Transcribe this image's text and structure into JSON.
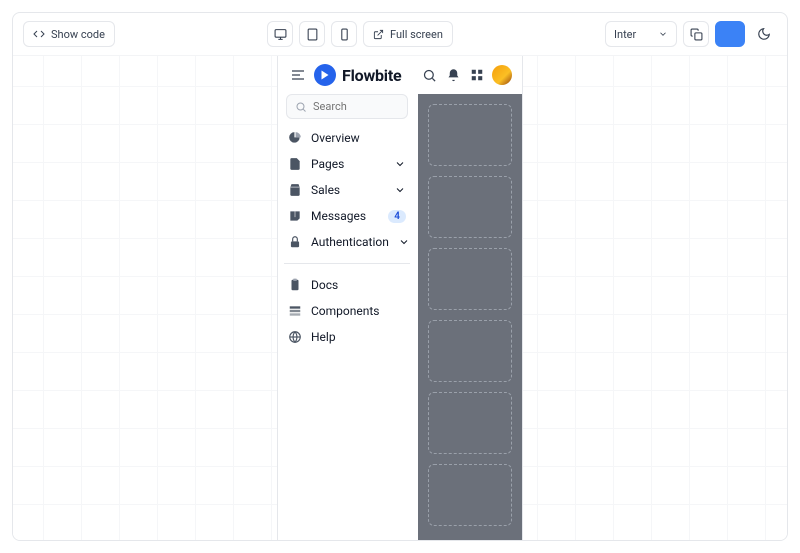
{
  "toolbar": {
    "show_code": "Show code",
    "full_screen": "Full screen",
    "font": "Inter"
  },
  "app": {
    "brand": "Flowbite",
    "search": {
      "placeholder": "Search"
    }
  },
  "sidebar": {
    "items": [
      {
        "label": "Overview"
      },
      {
        "label": "Pages"
      },
      {
        "label": "Sales"
      },
      {
        "label": "Messages",
        "badge": "4"
      },
      {
        "label": "Authentication"
      }
    ],
    "secondary": [
      {
        "label": "Docs"
      },
      {
        "label": "Components"
      },
      {
        "label": "Help"
      }
    ]
  }
}
